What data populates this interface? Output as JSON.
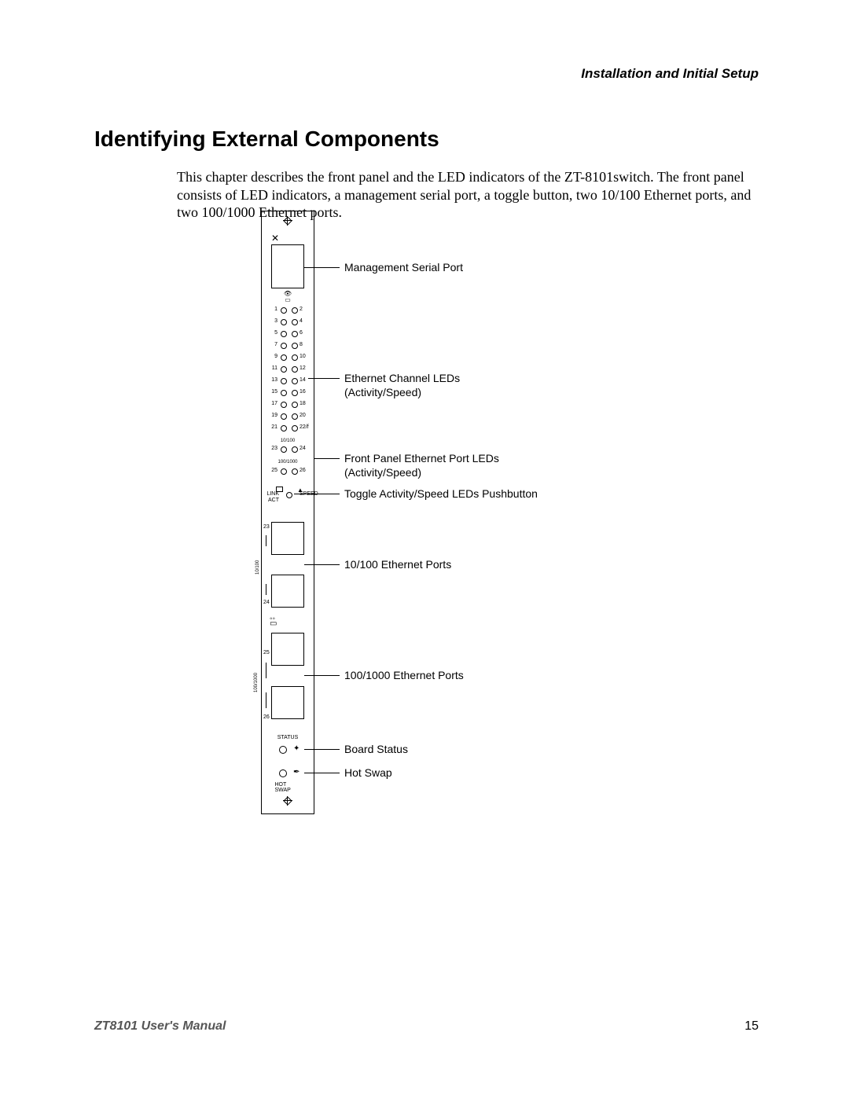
{
  "header": {
    "section": "Installation and Initial Setup"
  },
  "heading": "Identifying External Components",
  "paragraph": "This chapter describes the front panel and the LED indicators of the ZT-8101switch. The front panel consists of LED indicators, a management serial port, a toggle button, two 10/100 Ethernet ports, and two 100/1000 Ethernet ports.",
  "footer": {
    "left": "ZT8101 User's Manual",
    "page": "15"
  },
  "callouts": {
    "serial": "Management Serial Port",
    "channel_leds": "Ethernet Channel LEDs\n(Activity/Speed)",
    "fp_leds": "Front Panel Ethernet Port LEDs\n(Activity/Speed)",
    "toggle": "Toggle Activity/Speed LEDs Pushbutton",
    "eth_10_100": "10/100 Ethernet Ports",
    "eth_100_1000": "100/1000 Ethernet Ports",
    "board_status": "Board Status",
    "hot_swap": "Hot Swap"
  },
  "panel": {
    "led_rows": [
      {
        "l": "1",
        "r": "2"
      },
      {
        "l": "3",
        "r": "4"
      },
      {
        "l": "5",
        "r": "6"
      },
      {
        "l": "7",
        "r": "8"
      },
      {
        "l": "9",
        "r": "10"
      },
      {
        "l": "11",
        "r": "12"
      },
      {
        "l": "13",
        "r": "14"
      },
      {
        "l": "15",
        "r": "16"
      },
      {
        "l": "17",
        "r": "18"
      },
      {
        "l": "19",
        "r": "20"
      },
      {
        "l": "21",
        "r": "22/f"
      }
    ],
    "group_10_100": "10/100",
    "row_23_24": {
      "l": "23",
      "r": "24"
    },
    "group_100_1000": "100/1000",
    "row_25_26": {
      "l": "25",
      "r": "26"
    },
    "toggle_left": "LINK\nACT",
    "toggle_right": "SPEED",
    "side_23": "23",
    "side_24": "24",
    "side_rot_a": "10/100",
    "side_25": "25",
    "side_26": "26",
    "side_rot_b": "100/1000",
    "status": "STATUS",
    "hotswap": "HOT SWAP"
  }
}
